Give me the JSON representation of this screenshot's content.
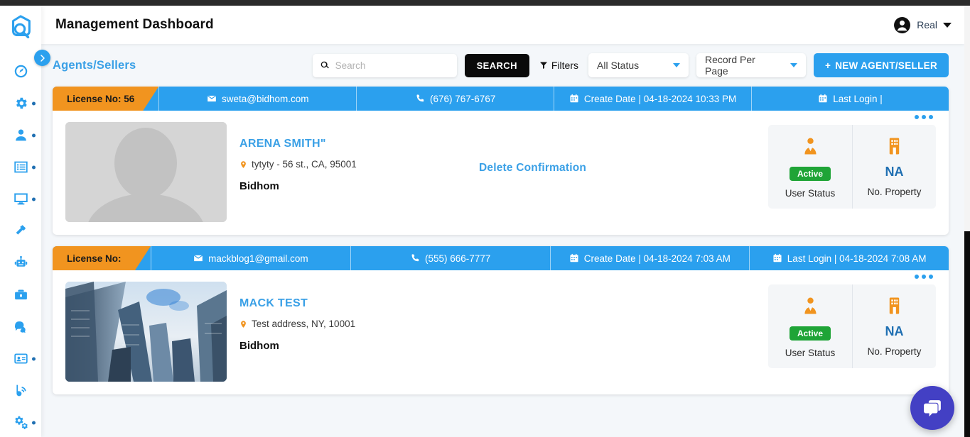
{
  "header": {
    "title": "Management Dashboard",
    "user_name": "Real",
    "user_icon": "account-circle-icon",
    "caret_icon": "chevron-down-icon"
  },
  "sidebar": {
    "logo": "bidhom-logo",
    "expand_icon": "chevron-right-icon",
    "items": [
      {
        "name": "dashboard",
        "icon": "speedometer-icon",
        "dot": false
      },
      {
        "name": "settings",
        "icon": "gear-icon",
        "dot": true
      },
      {
        "name": "users",
        "icon": "person-icon",
        "dot": true
      },
      {
        "name": "listings",
        "icon": "list-icon",
        "dot": true
      },
      {
        "name": "website",
        "icon": "monitor-icon",
        "dot": true
      },
      {
        "name": "tools",
        "icon": "hammer-icon",
        "dot": false
      },
      {
        "name": "automation",
        "icon": "robot-icon",
        "dot": false
      },
      {
        "name": "business",
        "icon": "briefcase-icon",
        "dot": false
      },
      {
        "name": "messages",
        "icon": "chat-icon",
        "dot": false
      },
      {
        "name": "contacts",
        "icon": "id-card-icon",
        "dot": true
      },
      {
        "name": "blog",
        "icon": "blog-icon",
        "dot": false
      },
      {
        "name": "config",
        "icon": "gears-icon",
        "dot": true
      }
    ]
  },
  "toolbar": {
    "page_heading": "Agents/Sellers",
    "search_placeholder": "Search",
    "search_value": "",
    "search_icon": "search-icon",
    "search_button": "SEARCH",
    "filters_label": "Filters",
    "filters_icon": "funnel-icon",
    "status_select": "All Status",
    "record_select": "Record Per Page",
    "new_button": "NEW AGENT/SELLER",
    "new_button_icon": "plus-icon"
  },
  "cards": [
    {
      "license": "License No: 56",
      "email": "sweta@bidhom.com",
      "phone": "(676) 767-6767",
      "create_date": "Create Date | 04-18-2024 10:33 PM",
      "last_login": "Last Login |",
      "thumb": "person-placeholder-image",
      "name": "ARENA SMITH\"",
      "address": "tytyty - 56 st., CA, 95001",
      "company": "Bidhom",
      "note": "Delete Confirmation",
      "status_badge": "Active",
      "status_label": "User Status",
      "property_value": "NA",
      "property_label": "No. Property",
      "status_icon": "agent-person-icon",
      "property_icon": "building-icon",
      "menu_icon": "more-dots-icon"
    },
    {
      "license": "License No:",
      "email": "mackblog1@gmail.com",
      "phone": "(555) 666-7777",
      "create_date": "Create Date | 04-18-2024 7:03 AM",
      "last_login": "Last Login | 04-18-2024 7:08 AM",
      "thumb": "skyscrapers-photo",
      "name": "MACK TEST",
      "address": "Test address, NY, 10001",
      "company": "Bidhom",
      "note": "",
      "status_badge": "Active",
      "status_label": "User Status",
      "property_value": "NA",
      "property_label": "No. Property",
      "status_icon": "agent-person-icon",
      "property_icon": "building-icon",
      "menu_icon": "more-dots-icon"
    }
  ],
  "chat": {
    "icon": "chat-bubble-icon"
  },
  "colors": {
    "primary_blue": "#2ba0ee",
    "orange": "#f1941f",
    "green": "#1fa437",
    "dark_blue": "#1f6fb2",
    "chat_purple": "#4340c4"
  }
}
